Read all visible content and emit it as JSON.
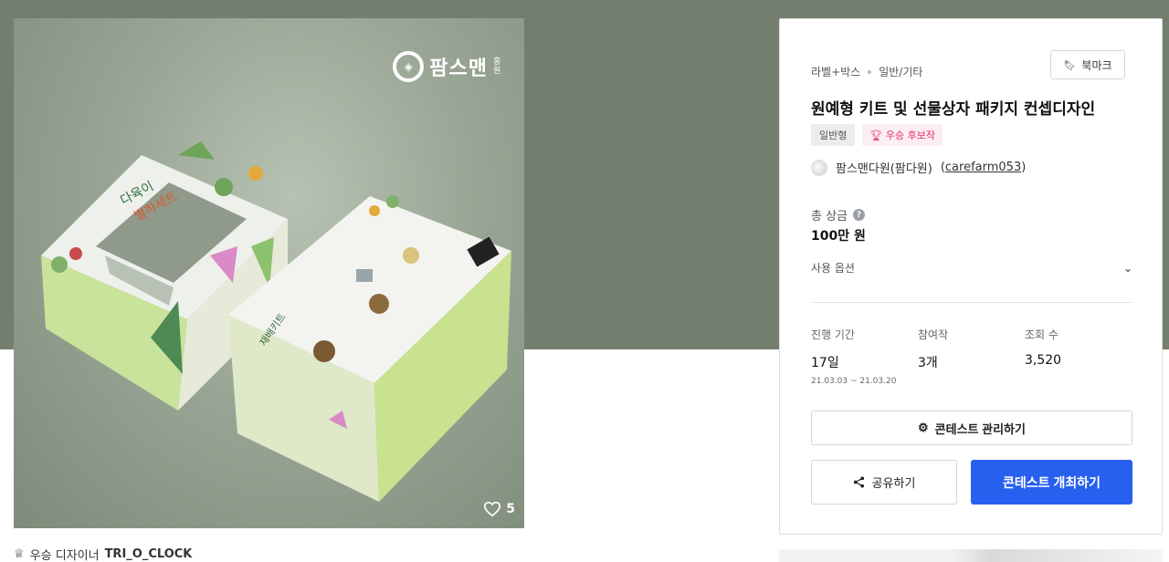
{
  "product": {
    "brand_logo_text": "팜스맨",
    "brand_logo_sub": "홍원",
    "like_count": "5"
  },
  "winner": {
    "label": "우승 디자이너",
    "name": "TRI_O_CLOCK"
  },
  "panel": {
    "category": "라벨+박스",
    "subcategory": "일반/기타",
    "bookmark_label": "북마크",
    "title": "원예형 키트 및 선물상자 패키지 컨셉디자인",
    "badge_general": "일반형",
    "badge_winner": "우승 후보작",
    "host_name": "팜스맨다원(팜다원)",
    "host_id_open": "(",
    "host_id": "carefarm053",
    "host_id_close": ")",
    "prize_label": "총 상금",
    "prize_value": "100만 원",
    "usage_label": "사용 옵션",
    "stats": [
      {
        "label": "진행 기간",
        "value": "17일",
        "sub": "21.03.03 ~ 21.03.20"
      },
      {
        "label": "참여작",
        "value": "3개"
      },
      {
        "label": "조회 수",
        "value": "3,520"
      }
    ],
    "manage_label": "콘테스트 관리하기",
    "share_label": "공유하기",
    "host_label": "콘테스트 개최하기"
  },
  "colors": {
    "hero_band": "#737e6e",
    "primary": "#2760ee",
    "winner_badge": "#e0306d"
  }
}
